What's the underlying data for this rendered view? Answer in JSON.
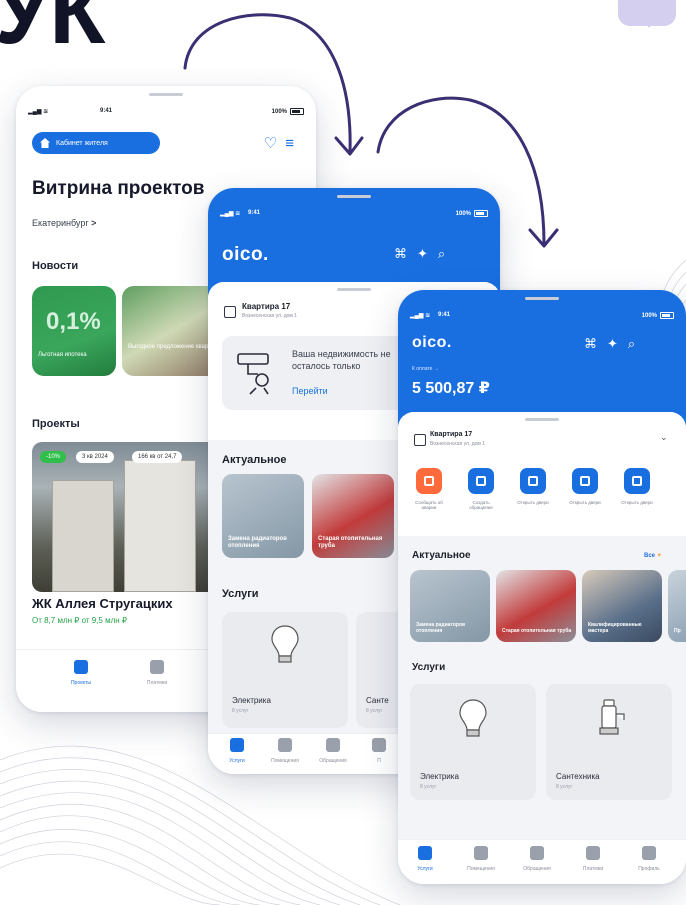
{
  "hero": {
    "title": "УК"
  },
  "colors": {
    "accent": "#1a6fe0",
    "green": "#2fbf4a",
    "arrow": "#3b2e72"
  },
  "phone1": {
    "status": {
      "time": "9:41",
      "battery": "100%"
    },
    "cabinet_chip": "Кабинет жителя",
    "title": "Витрина проектов",
    "city": "Екатеринбург",
    "news_label": "Новости",
    "news": [
      {
        "big": "0,1%",
        "caption": "Льготная ипотека"
      },
      {
        "caption": "Выгодное предложение квартира"
      }
    ],
    "projects_label": "Проекты",
    "project": {
      "pills": [
        "-10%",
        "3 кв 2024",
        "166 кв от 24,7"
      ],
      "name": "ЖК Аллея Стругацких",
      "price": "От 8,7 млн ₽ от 9,5 млн ₽"
    },
    "nav": [
      "Проекты",
      "Платежи"
    ]
  },
  "phone2": {
    "status": {
      "time": "9:41",
      "battery": "100%"
    },
    "logo": "oico.",
    "apartment": {
      "name": "Квартира 17",
      "sub": "Вознесенская ул. дом 1"
    },
    "promo": {
      "text": "Ваша недвижимость не осталось только",
      "link": "Перейти"
    },
    "actual_label": "Актуальное",
    "actual": [
      {
        "caption": "Замена радиаторов отопления"
      },
      {
        "caption": "Старая отопительная труба"
      }
    ],
    "services_label": "Услуги",
    "services": [
      {
        "name": "Электрика",
        "count": "8 услуг"
      },
      {
        "name": "Санте",
        "count": "8 услуг"
      }
    ],
    "nav": [
      "Услуги",
      "Помещения",
      "Обращения",
      "П"
    ]
  },
  "phone3": {
    "status": {
      "time": "9:41",
      "battery": "100%"
    },
    "logo": "oico.",
    "balance_label": "К оплате →",
    "balance": "5 500,87 ₽",
    "apartment": {
      "name": "Квартира 17",
      "sub": "Вознесенская ул. дом 1"
    },
    "quick_actions": [
      {
        "label": "Сообщить об аварии",
        "style": "red"
      },
      {
        "label": "Создать обращение",
        "style": "blue"
      },
      {
        "label": "Открыть двери",
        "style": "blue"
      },
      {
        "label": "Открыть двери",
        "style": "blue"
      },
      {
        "label": "Открыть двери",
        "style": "blue"
      }
    ],
    "actual_label": "Актуальное",
    "all_link": "Все",
    "actual": [
      {
        "caption": "Замена радиаторов отопления"
      },
      {
        "caption": "Старая отопительная труба"
      },
      {
        "caption": "Квалифицированные мастера"
      },
      {
        "caption": "Пр"
      }
    ],
    "services_label": "Услуги",
    "services": [
      {
        "name": "Электрика",
        "count": "8 услуг"
      },
      {
        "name": "Сантехника",
        "count": "8 услуг"
      }
    ],
    "nav": [
      "Услуги",
      "Помещения",
      "Обращения",
      "Платежи",
      "Профиль"
    ]
  }
}
